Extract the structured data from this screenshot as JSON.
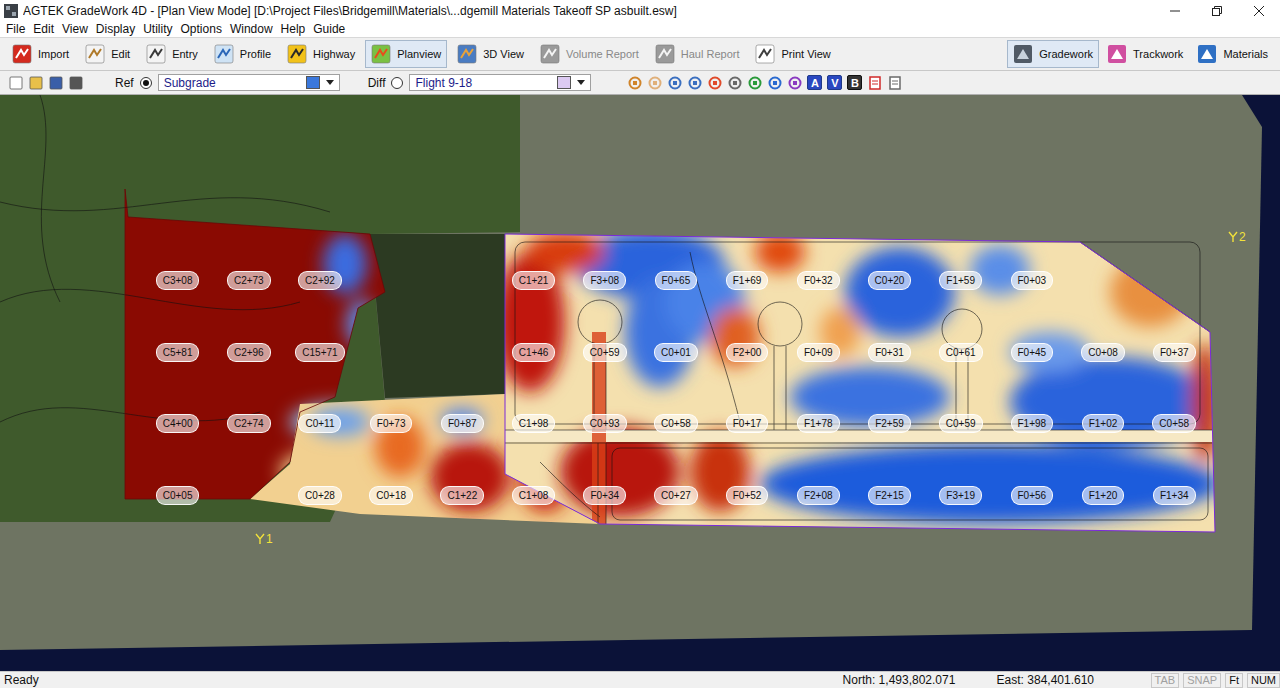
{
  "window": {
    "title": "AGTEK GradeWork 4D - [Plan View Mode] [D:\\Project Files\\Bridgemill\\Materials\\...dgemill Materials Takeoff SP asbuilt.esw]"
  },
  "menu": [
    "File",
    "Edit",
    "View",
    "Display",
    "Utility",
    "Options",
    "Window",
    "Help",
    "Guide"
  ],
  "toolbar": [
    {
      "label": "Import",
      "selected": false,
      "disabled": false
    },
    {
      "label": "Edit",
      "selected": false,
      "disabled": false
    },
    {
      "label": "Entry",
      "selected": false,
      "disabled": false
    },
    {
      "label": "Profile",
      "selected": false,
      "disabled": false
    },
    {
      "label": "Highway",
      "selected": false,
      "disabled": false
    },
    {
      "label": "Planview",
      "selected": true,
      "disabled": false
    },
    {
      "label": "3D View",
      "selected": false,
      "disabled": false
    },
    {
      "label": "Volume Report",
      "selected": false,
      "disabled": true
    },
    {
      "label": "Haul Report",
      "selected": false,
      "disabled": true
    },
    {
      "label": "Print View",
      "selected": false,
      "disabled": false
    }
  ],
  "modes": [
    {
      "label": "Gradework",
      "selected": true
    },
    {
      "label": "Trackwork",
      "selected": false
    },
    {
      "label": "Materials",
      "selected": false
    }
  ],
  "surface_bar": {
    "ref": {
      "label": "Ref",
      "selected": true,
      "surface": "Subgrade",
      "color": "#3b78dc"
    },
    "diff": {
      "label": "Diff",
      "selected": false,
      "surface": "Flight 9-18",
      "color": "#dccaf2"
    },
    "letter_buttons": [
      {
        "label": "A",
        "on": true
      },
      {
        "label": "V",
        "on": true
      },
      {
        "label": "B",
        "on": false
      }
    ]
  },
  "map": {
    "label_rows": [
      [
        "C3+08",
        "C2+73",
        "C2+92",
        "",
        "",
        "C1+21",
        "F3+08",
        "F0+65",
        "F1+69",
        "F0+32",
        "C0+20",
        "F1+59",
        "F0+03",
        "",
        ""
      ],
      [
        "C5+81",
        "C2+96",
        "C15+71",
        "",
        "",
        "C1+46",
        "C0+59",
        "C0+01",
        "F2+00",
        "F0+09",
        "F0+31",
        "C0+61",
        "F0+45",
        "C0+08",
        "F0+37"
      ],
      [
        "C4+00",
        "C2+74",
        "C0+11",
        "F0+73",
        "F0+87",
        "C1+98",
        "C0+93",
        "C0+58",
        "F0+17",
        "F1+78",
        "F2+59",
        "C0+59",
        "F1+98",
        "F1+02",
        "C0+58"
      ],
      [
        "C0+05",
        "",
        "C0+28",
        "C0+18",
        "C1+22",
        "C1+08",
        "F0+34",
        "C0+27",
        "F0+52",
        "F2+08",
        "F2+15",
        "F3+19",
        "F0+56",
        "F1+20",
        "F1+34"
      ]
    ],
    "pins": [
      "1",
      "2"
    ]
  },
  "status_bar": {
    "message": "Ready",
    "north": "North: 1,493,802.071",
    "east": "East: 384,401.610",
    "indicators": [
      {
        "label": "TAB",
        "on": false
      },
      {
        "label": "SNAP",
        "on": false
      },
      {
        "label": "Ft",
        "on": true
      },
      {
        "label": "NUM",
        "on": true
      }
    ]
  }
}
